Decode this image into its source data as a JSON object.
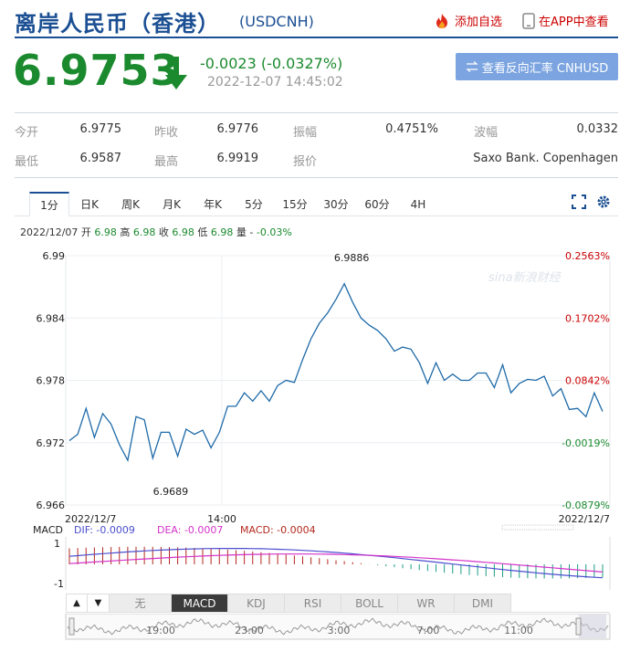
{
  "header": {
    "title": "离岸人民币（香港）",
    "code": "(USDCNH)",
    "add_fav": "添加自选",
    "app_view": "在APP中查看"
  },
  "quote": {
    "price": "6.9753",
    "change": "-0.0023 (-0.0327%)",
    "time": "2022-12-07 14:45:02",
    "reverse_btn": "查看反向汇率 CNHUSD"
  },
  "stats": {
    "open_label": "今开",
    "open": "6.9775",
    "prev_label": "昨收",
    "prev": "6.9776",
    "amp_label": "振幅",
    "amp": "0.4751%",
    "wave_label": "波幅",
    "wave": "0.0332",
    "low_label": "最低",
    "low": "6.9587",
    "high_label": "最高",
    "high": "6.9919",
    "source_label": "报价",
    "source": "Saxo Bank. Copenhagen"
  },
  "tabs": [
    "1分",
    "日K",
    "周K",
    "月K",
    "年K",
    "5分",
    "15分",
    "30分",
    "60分",
    "4H"
  ],
  "info_line": {
    "date": "2022/12/07",
    "open_l": "开",
    "open": "6.98",
    "high_l": "高",
    "high": "6.98",
    "close_l": "收",
    "close": "6.98",
    "low_l": "低",
    "low": "6.98",
    "vol_l": "量",
    "vol": "-",
    "pct": "-0.03%"
  },
  "watermark": "sina新浪财经",
  "chart_data": {
    "type": "line",
    "y_ticks": [
      "6.99",
      "6.984",
      "6.978",
      "6.972",
      "6.966"
    ],
    "pct_ticks": [
      "0.2563%",
      "0.1702%",
      "0.0842%",
      "-0.0019%",
      "-0.0879%"
    ],
    "x_labels": [
      "2022/12/7",
      "14:00",
      "2022/12/7"
    ],
    "ylim": [
      6.966,
      6.99
    ],
    "max_label": "6.9886",
    "min_label": "6.9689",
    "max_value": 6.9886,
    "min_value": 6.9689,
    "x_count": 65,
    "series": [
      {
        "color": "#1e6aa8",
        "values": [
          6.9722,
          6.9728,
          6.9753,
          6.9725,
          6.9748,
          6.9738,
          6.9718,
          6.9703,
          6.9745,
          6.9742,
          6.9705,
          6.973,
          6.973,
          6.9707,
          6.9733,
          6.9728,
          6.9732,
          6.9715,
          6.973,
          6.9755,
          6.9755,
          6.9768,
          6.976,
          6.977,
          6.976,
          6.9775,
          6.978,
          6.9778,
          6.98,
          6.982,
          6.9835,
          6.9845,
          6.9858,
          6.9873,
          6.9855,
          6.984,
          6.9833,
          6.9828,
          6.982,
          6.9808,
          6.9812,
          6.981,
          6.9797,
          6.9777,
          6.9797,
          6.978,
          6.9786,
          6.978,
          6.978,
          6.9787,
          6.9787,
          6.9773,
          6.9795,
          6.9768,
          6.9777,
          6.9781,
          6.978,
          6.9784,
          6.9765,
          6.9772,
          6.9752,
          6.9753,
          6.9745,
          6.9768,
          6.975
        ]
      }
    ]
  },
  "macd": {
    "label": "MACD",
    "dif": "DIF: -0.0009",
    "dea": "DEA: -0.0007",
    "macd": "MACD: -0.0004",
    "y_top": "1",
    "y_bot": "-1",
    "colors": {
      "dif": "#4b4ecf",
      "dea": "#d433c9",
      "macd": "#b3291e",
      "up": "#b3291e",
      "down": "#1b9c86"
    }
  },
  "indicators": {
    "buttons": [
      "无",
      "MACD",
      "KDJ",
      "RSI",
      "BOLL",
      "WR",
      "DMI"
    ],
    "active": "MACD"
  },
  "navigator": {
    "labels": [
      "19:00",
      "23:00",
      "3:00",
      "7:00",
      "11:00"
    ]
  },
  "colors": {
    "brand": "#1b4f93",
    "down": "#1b8a2e",
    "up": "#c00"
  }
}
